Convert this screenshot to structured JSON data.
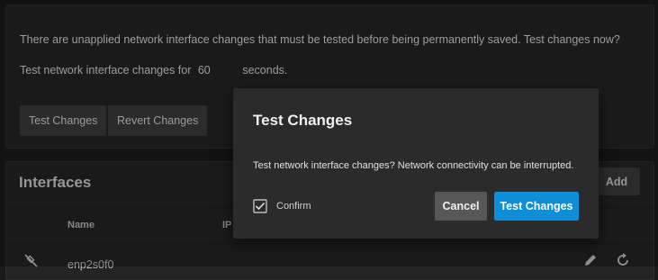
{
  "banner": {
    "message": "There are unapplied network interface changes that must be tested before being permanently saved. Test changes now?",
    "timer_prefix": "Test network interface changes for",
    "timer_value": "60",
    "timer_unit": "seconds.",
    "test_button": "Test Changes",
    "revert_button": "Revert Changes"
  },
  "interfaces": {
    "title": "Interfaces",
    "add_button": "Add",
    "columns": [
      "Name",
      "IP"
    ],
    "rows": [
      {
        "name": "enp2s0f0",
        "icon": "network-disconnected-icon"
      }
    ]
  },
  "dialog": {
    "title": "Test Changes",
    "message": "Test network interface changes? Network connectivity can be interrupted.",
    "confirm_checkbox_label": "Confirm",
    "confirm_checked": true,
    "cancel_button": "Cancel",
    "confirm_button": "Test Changes"
  },
  "colors": {
    "accent": "#0d8ed9",
    "panel": "#242424",
    "background": "#1a1a1a"
  }
}
